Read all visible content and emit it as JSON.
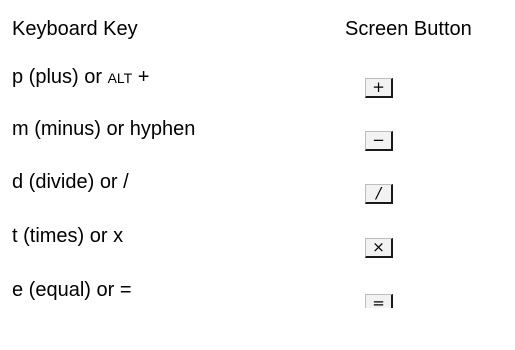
{
  "headers": {
    "keyboard_key": "Keyboard Key",
    "screen_button": "Screen Button"
  },
  "rows": [
    {
      "label": "p (plus) or ",
      "label_small": "ALT",
      "label_tail": " +",
      "button_glyph": "+",
      "icon": "plus-icon"
    },
    {
      "label": "m (minus) or hyphen",
      "button_glyph": "−",
      "icon": "minus-icon"
    },
    {
      "label": "d (divide) or /",
      "button_glyph": "/",
      "icon": "divide-icon"
    },
    {
      "label": "t (times) or x",
      "button_glyph": "×",
      "icon": "multiply-icon"
    },
    {
      "label": "e (equal) or =",
      "button_glyph": "=",
      "icon": "equals-icon"
    }
  ]
}
